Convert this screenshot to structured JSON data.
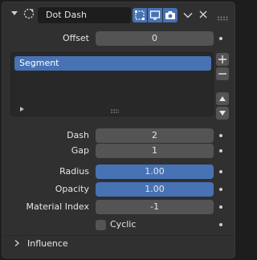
{
  "header": {
    "name": "Dot Dash"
  },
  "offset": {
    "label": "Offset",
    "value": "0"
  },
  "segments": {
    "items": [
      {
        "label": "Segment"
      }
    ]
  },
  "dash": {
    "label": "Dash",
    "value": "2"
  },
  "gap": {
    "label": "Gap",
    "value": "1"
  },
  "radius": {
    "label": "Radius",
    "value": "1.00"
  },
  "opacity": {
    "label": "Opacity",
    "value": "1.00"
  },
  "material_index": {
    "label": "Material Index",
    "value": "-1"
  },
  "cyclic": {
    "label": "Cyclic",
    "checked": false
  },
  "influence": {
    "label": "Influence"
  },
  "colors": {
    "accent": "#4772b3",
    "panel": "#303030",
    "field": "#545454",
    "field_dark": "#1d1d1d"
  }
}
